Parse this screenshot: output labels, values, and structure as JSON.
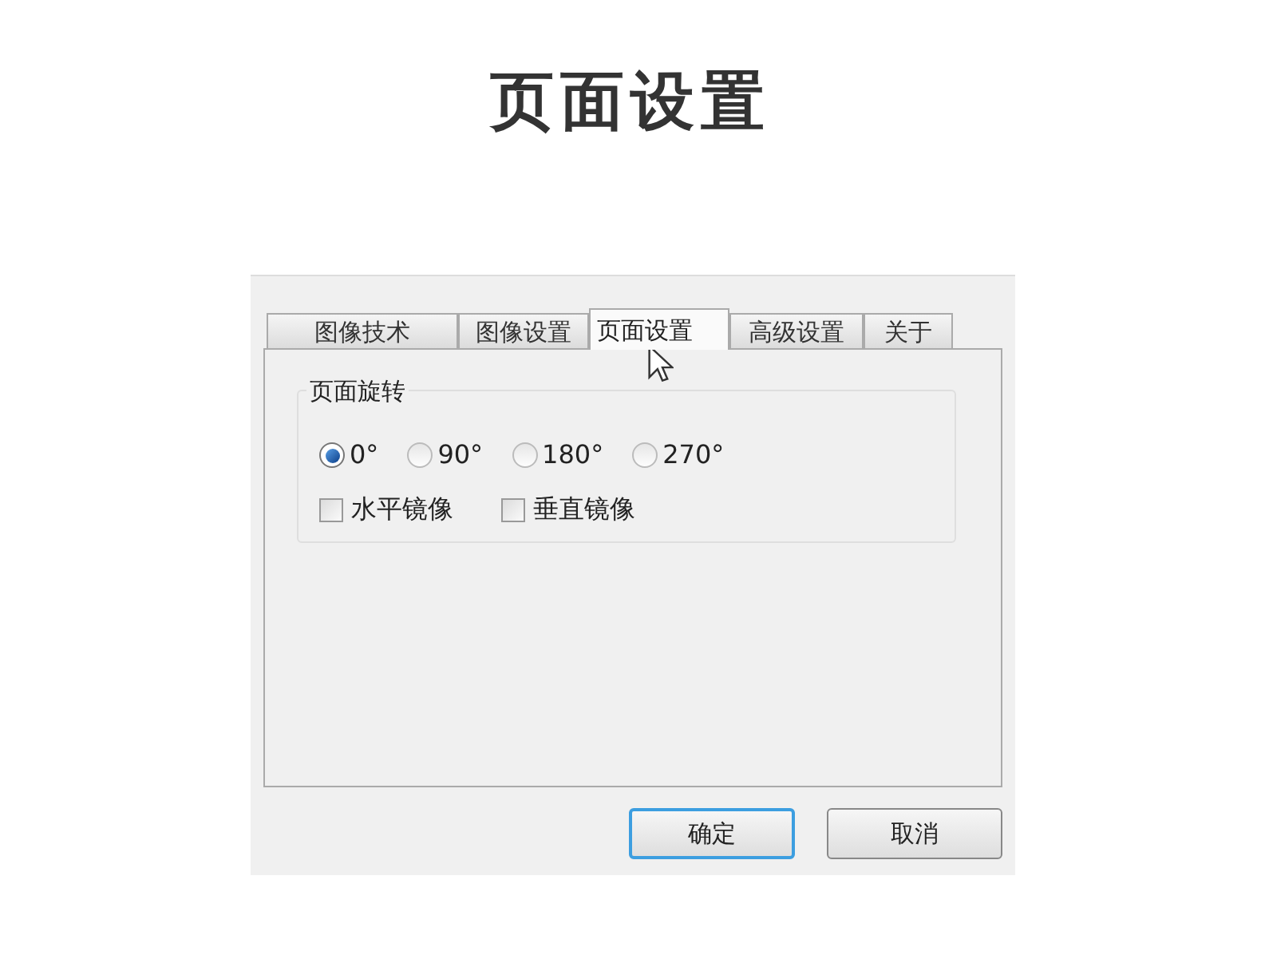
{
  "heading": "页面设置",
  "tabs": [
    {
      "label": "图像技术",
      "selected": false
    },
    {
      "label": "图像设置",
      "selected": false
    },
    {
      "label": "页面设置",
      "selected": true
    },
    {
      "label": "高级设置",
      "selected": false
    },
    {
      "label": "关于",
      "selected": false
    }
  ],
  "group": {
    "title": "页面旋转",
    "radios": [
      {
        "label": "0°",
        "selected": true
      },
      {
        "label": "90°",
        "selected": false
      },
      {
        "label": "180°",
        "selected": false
      },
      {
        "label": "270°",
        "selected": false
      }
    ],
    "checkboxes": [
      {
        "label": "水平镜像",
        "checked": false
      },
      {
        "label": "垂直镜像",
        "checked": false
      }
    ]
  },
  "buttons": [
    {
      "label": "确定",
      "default": true
    },
    {
      "label": "取消",
      "default": false
    }
  ]
}
